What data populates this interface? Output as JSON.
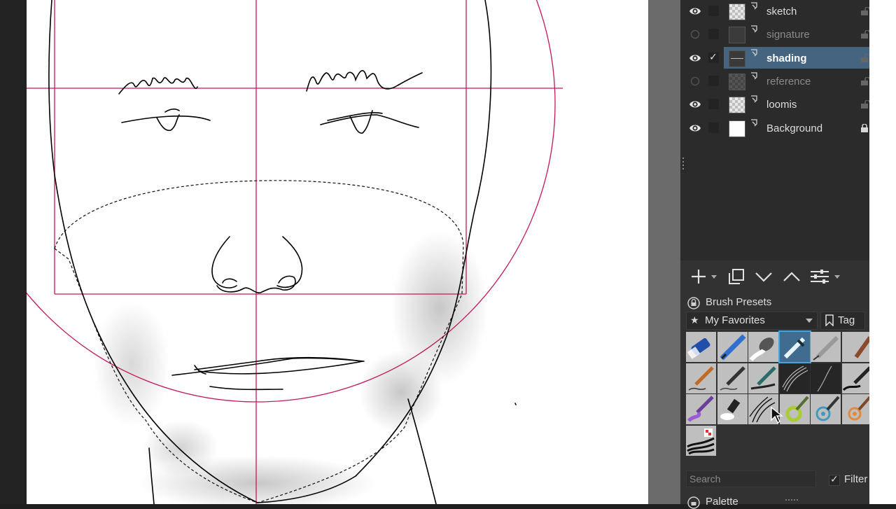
{
  "layers": {
    "items": [
      {
        "name": "sketch",
        "visible": true,
        "checked": false,
        "thumb": "checker",
        "locked": false,
        "selected": false
      },
      {
        "name": "signature",
        "visible": false,
        "checked": false,
        "thumb": "dark",
        "locked": false,
        "selected": false
      },
      {
        "name": "shading",
        "visible": true,
        "checked": true,
        "thumb": "line",
        "locked": false,
        "selected": true
      },
      {
        "name": "reference",
        "visible": false,
        "checked": false,
        "thumb": "darkchecker",
        "locked": false,
        "selected": false
      },
      {
        "name": "loomis",
        "visible": true,
        "checked": false,
        "thumb": "checker",
        "locked": false,
        "selected": false
      },
      {
        "name": "Background",
        "visible": true,
        "checked": false,
        "thumb": "white",
        "locked": true,
        "selected": false
      }
    ],
    "check_glyph": "✓"
  },
  "layer_toolbar": {
    "icons": [
      "add-layer-icon",
      "duplicate-layer-icon",
      "move-layer-down-icon",
      "move-layer-up-icon",
      "layer-properties-icon"
    ]
  },
  "brush_presets": {
    "title": "Brush Presets",
    "filter_tag": "My Favorites",
    "tag_button": "Tag",
    "search_placeholder": "Search",
    "filter_label": "Filter",
    "filter_checked": true,
    "presets": [
      {
        "name": "eraser-preset",
        "style": "light"
      },
      {
        "name": "blue-pen-preset",
        "style": "light"
      },
      {
        "name": "blender-preset",
        "style": "light"
      },
      {
        "name": "selected-pen-preset",
        "style": "selected"
      },
      {
        "name": "ink-pen-preset",
        "style": "light"
      },
      {
        "name": "brush-preset-6",
        "style": "light"
      },
      {
        "name": "pencil-preset",
        "style": "light"
      },
      {
        "name": "marker-preset",
        "style": "light"
      },
      {
        "name": "teal-pen-preset",
        "style": "light"
      },
      {
        "name": "hair-brush-preset",
        "style": "dark"
      },
      {
        "name": "soft-line-preset",
        "style": "dark"
      },
      {
        "name": "brush-preset-12",
        "style": "light"
      },
      {
        "name": "purple-paint-preset",
        "style": "light"
      },
      {
        "name": "smudge-preset",
        "style": "light"
      },
      {
        "name": "hair-strokes-preset",
        "style": "light"
      },
      {
        "name": "green-ring-preset",
        "style": "light"
      },
      {
        "name": "blue-pattern-preset",
        "style": "light"
      },
      {
        "name": "orange-pattern-preset",
        "style": "light"
      },
      {
        "name": "texture-brush-preset",
        "style": "light"
      }
    ]
  },
  "palette": {
    "title": "Palette"
  },
  "colors": {
    "guide": "#c2185b",
    "selected_layer": "#44647f",
    "selected_preset": "#3f6c8f"
  }
}
